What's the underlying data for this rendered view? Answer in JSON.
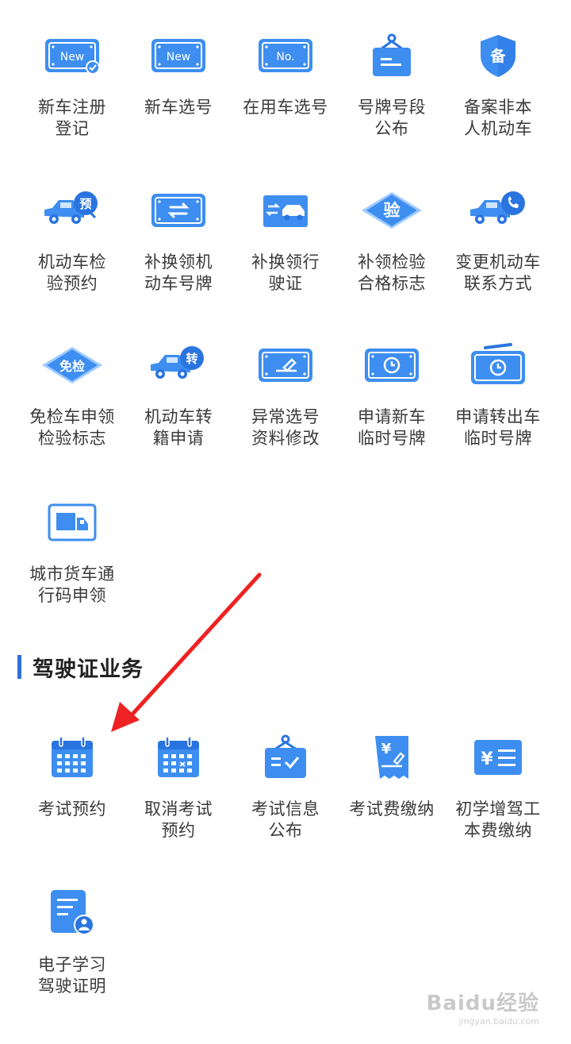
{
  "vehicle_services": {
    "items": [
      {
        "label": "新车注册\n登记",
        "icon": "new-plate-check-icon"
      },
      {
        "label": "新车选号",
        "icon": "new-plate-icon"
      },
      {
        "label": "在用车选号",
        "icon": "no-plate-icon"
      },
      {
        "label": "号牌号段\n公布",
        "icon": "hanging-sign-icon"
      },
      {
        "label": "备案非本\n人机动车",
        "icon": "shield-bei-icon"
      },
      {
        "label": "机动车检\n验预约",
        "icon": "car-yu-icon"
      },
      {
        "label": "补换领机\n动车号牌",
        "icon": "plate-exchange-icon"
      },
      {
        "label": "补换领行\n驶证",
        "icon": "car-exchange-icon"
      },
      {
        "label": "补领检验\n合格标志",
        "icon": "diamond-yan-icon"
      },
      {
        "label": "变更机动车\n联系方式",
        "icon": "car-phone-icon"
      },
      {
        "label": "免检车申领\n检验标志",
        "icon": "diamond-mianjian-icon"
      },
      {
        "label": "机动车转\n籍申请",
        "icon": "car-zhuan-icon"
      },
      {
        "label": "异常选号\n资料修改",
        "icon": "plate-edit-icon"
      },
      {
        "label": "申请新车\n临时号牌",
        "icon": "plate-clock-icon"
      },
      {
        "label": "申请转出车\n临时号牌",
        "icon": "plate-clock-tab-icon"
      },
      {
        "label": "城市货车通\n行码申领",
        "icon": "truck-card-icon"
      }
    ]
  },
  "license_section": {
    "title": "驾驶证业务",
    "items": [
      {
        "label": "考试预约",
        "icon": "calendar-icon"
      },
      {
        "label": "取消考试\n预约",
        "icon": "calendar-cancel-icon"
      },
      {
        "label": "考试信息\n公布",
        "icon": "board-check-icon"
      },
      {
        "label": "考试费缴纳",
        "icon": "receipt-yen-icon"
      },
      {
        "label": "初学增驾工\n本费缴纳",
        "icon": "card-yen-icon"
      },
      {
        "label": "电子学习\n驾驶证明",
        "icon": "doc-person-icon"
      }
    ]
  },
  "colors": {
    "accent": "#2f6fd4",
    "icon_blue": "#3d8ef0",
    "icon_light": "#8fc3ff",
    "arrow": "#ee2222"
  },
  "watermark": {
    "top": "Baidu经验",
    "bottom": "jingyan.baidu.com"
  }
}
